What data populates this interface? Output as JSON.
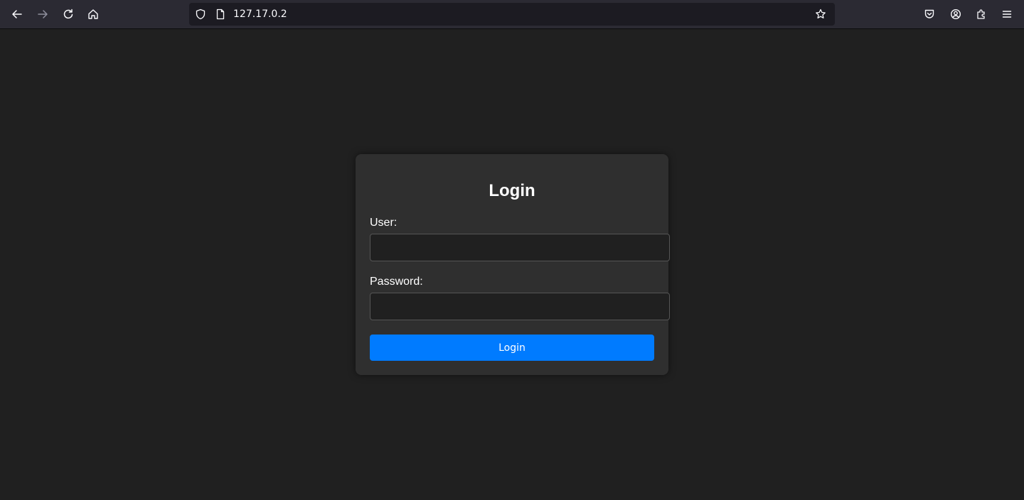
{
  "browser": {
    "url": "127.17.0.2",
    "icons": {
      "back": "back-arrow-icon",
      "forward": "forward-arrow-icon",
      "reload": "reload-icon",
      "home": "home-icon",
      "shield": "shield-icon",
      "page": "page-icon",
      "bookmark": "star-icon",
      "pocket": "pocket-icon",
      "account": "account-icon",
      "extensions": "puzzle-icon",
      "menu": "hamburger-menu-icon"
    }
  },
  "login": {
    "title": "Login",
    "user_label": "User:",
    "user_value": "",
    "password_label": "Password:",
    "password_value": "",
    "button_label": "Login"
  },
  "colors": {
    "page_bg": "#202020",
    "card_bg": "#2f2f2f",
    "accent": "#007bff",
    "toolbar_bg": "#2b2a33"
  }
}
